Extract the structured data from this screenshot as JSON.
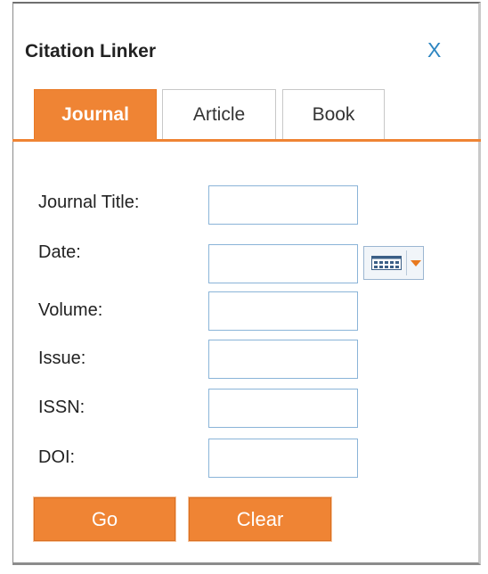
{
  "dialog": {
    "title": "Citation Linker",
    "close_label": "X"
  },
  "tabs": [
    {
      "label": "Journal",
      "active": true
    },
    {
      "label": "Article",
      "active": false
    },
    {
      "label": "Book",
      "active": false
    }
  ],
  "form": {
    "fields": [
      {
        "label": "Journal Title:",
        "value": ""
      },
      {
        "label": "Date:",
        "value": ""
      },
      {
        "label": "Volume:",
        "value": ""
      },
      {
        "label": "Issue:",
        "value": ""
      },
      {
        "label": "ISSN:",
        "value": ""
      },
      {
        "label": "DOI:",
        "value": ""
      }
    ],
    "date_picker_icon": "calendar-icon"
  },
  "buttons": {
    "go_label": "Go",
    "clear_label": "Clear"
  },
  "colors": {
    "accent": "#ef8434",
    "close": "#2e86c1",
    "field_border": "#8ab4d8"
  }
}
